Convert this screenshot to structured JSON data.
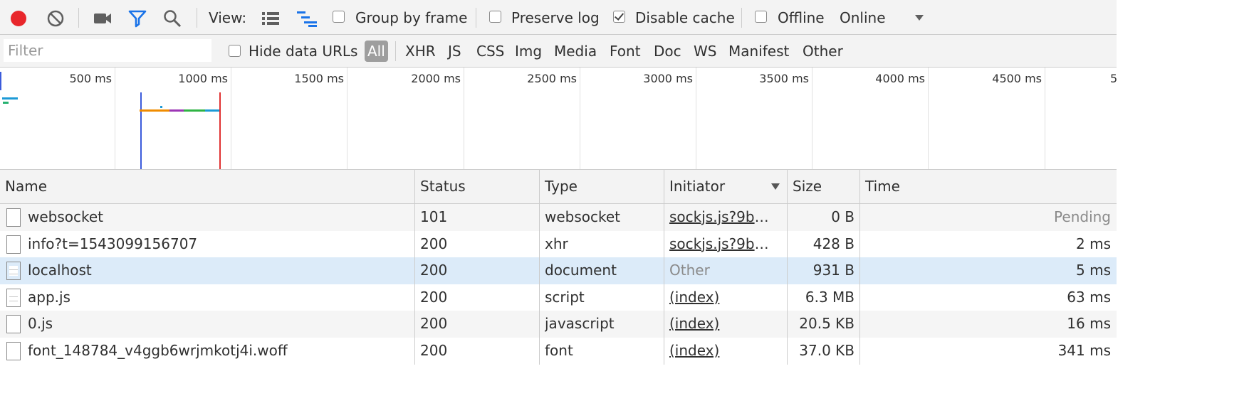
{
  "toolbar": {
    "view_label": "View:",
    "group_by_frame": {
      "label": "Group by frame",
      "checked": false
    },
    "preserve_log": {
      "label": "Preserve log",
      "checked": false
    },
    "disable_cache": {
      "label": "Disable cache",
      "checked": true
    },
    "offline": {
      "label": "Offline",
      "checked": false
    },
    "throttle_value": "Online",
    "record_color": "#e8262b",
    "filter_icon_color": "#1a73e8"
  },
  "filterbar": {
    "placeholder": "Filter",
    "hide_data_urls": {
      "label": "Hide data URLs",
      "checked": false
    },
    "types": [
      "All",
      "XHR",
      "JS",
      "CSS",
      "Img",
      "Media",
      "Font",
      "Doc",
      "WS",
      "Manifest",
      "Other"
    ],
    "active_type": "All"
  },
  "overview": {
    "ticks": [
      "500 ms",
      "1000 ms",
      "1500 ms",
      "2000 ms",
      "2500 ms",
      "3000 ms",
      "3500 ms",
      "4000 ms",
      "4500 ms",
      "5"
    ],
    "dom_content_loaded_color": "#3b5bdb",
    "load_color": "#e03131"
  },
  "table": {
    "columns": {
      "name": "Name",
      "status": "Status",
      "type": "Type",
      "initiator": "Initiator",
      "size": "Size",
      "time": "Time"
    },
    "rows": [
      {
        "name": "websocket",
        "status": "101",
        "type": "websocket",
        "initiator": "sockjs.js?9be…",
        "initiator_link": true,
        "size": "0 B",
        "time": "Pending"
      },
      {
        "name": "info?t=1543099156707",
        "status": "200",
        "type": "xhr",
        "initiator": "sockjs.js?9be…",
        "initiator_link": true,
        "size": "428 B",
        "time": "2 ms"
      },
      {
        "name": "localhost",
        "status": "200",
        "type": "document",
        "initiator": "Other",
        "initiator_link": false,
        "size": "931 B",
        "time": "5 ms"
      },
      {
        "name": "app.js",
        "status": "200",
        "type": "script",
        "initiator": "(index)",
        "initiator_link": true,
        "size": "6.3 MB",
        "time": "63 ms"
      },
      {
        "name": "0.js",
        "status": "200",
        "type": "javascript",
        "initiator": "(index)",
        "initiator_link": true,
        "size": "20.5 KB",
        "time": "16 ms"
      },
      {
        "name": "font_148784_v4ggb6wrjmkotj4i.woff",
        "status": "200",
        "type": "font",
        "initiator": "(index)",
        "initiator_link": true,
        "size": "37.0 KB",
        "time": "341 ms"
      }
    ]
  }
}
